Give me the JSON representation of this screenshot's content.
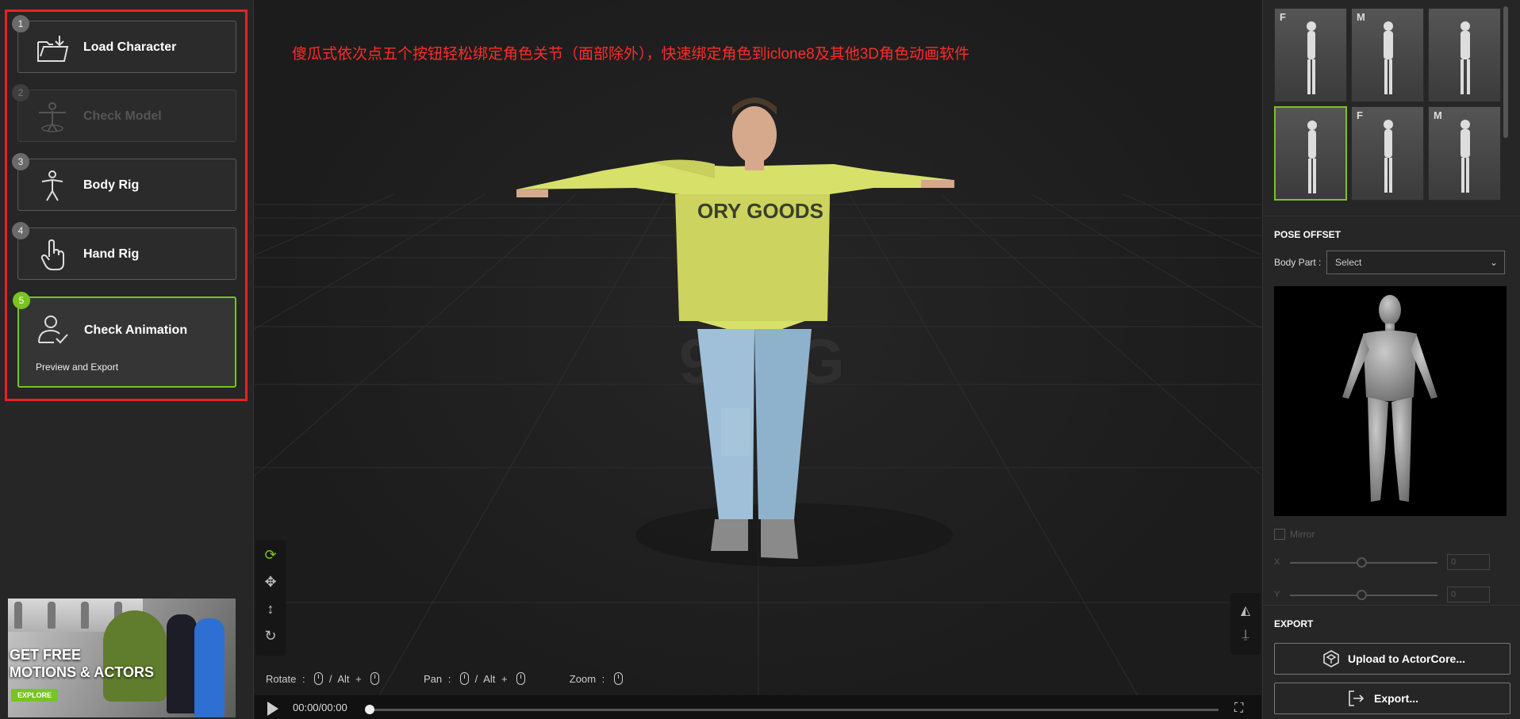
{
  "steps": [
    {
      "num": "1",
      "label": "Load Character",
      "state": "normal",
      "icon": "folder-import-icon"
    },
    {
      "num": "2",
      "label": "Check Model",
      "state": "disabled",
      "icon": "t-pose-figure-icon"
    },
    {
      "num": "3",
      "label": "Body Rig",
      "state": "normal",
      "icon": "body-figure-icon"
    },
    {
      "num": "4",
      "label": "Hand Rig",
      "state": "normal",
      "icon": "hand-pointer-icon"
    },
    {
      "num": "5",
      "label": "Check Animation",
      "state": "active",
      "sub": "Preview and Export",
      "icon": "user-check-icon"
    }
  ],
  "ad": {
    "headline_1": "GET FREE",
    "headline_2": "MOTIONS & ACTORS",
    "cta": "EXPLORE"
  },
  "viewport": {
    "caption": "傻瓜式依次点五个按钮轻松绑定角色关节（面部除外），快速绑定角色到iclone8及其他3D角色动画软件",
    "watermark": "92CG",
    "hints": {
      "rotate": "Rotate",
      "pan": "Pan",
      "zoom": "Zoom",
      "alt": "Alt",
      "plus": "+",
      "slash": "/",
      "colon": ":"
    },
    "time": "00:00/00:00"
  },
  "thumbnails": [
    {
      "gender": "F"
    },
    {
      "gender": "M"
    },
    {
      "gender": ""
    },
    {
      "gender": "",
      "selected": true
    },
    {
      "gender": "F"
    },
    {
      "gender": "M"
    }
  ],
  "pose_offset": {
    "title": "POSE OFFSET",
    "body_part_label": "Body Part :",
    "body_part_value": "Select",
    "mirror_label": "Mirror",
    "x_label": "X",
    "y_label": "Y",
    "x_value": "0",
    "y_value": "0"
  },
  "export": {
    "title": "EXPORT",
    "upload_label": "Upload to ActorCore...",
    "export_label": "Export..."
  },
  "colors": {
    "accent": "#79c322",
    "highlight_frame": "#e82127",
    "caption": "#ff2b2b"
  }
}
